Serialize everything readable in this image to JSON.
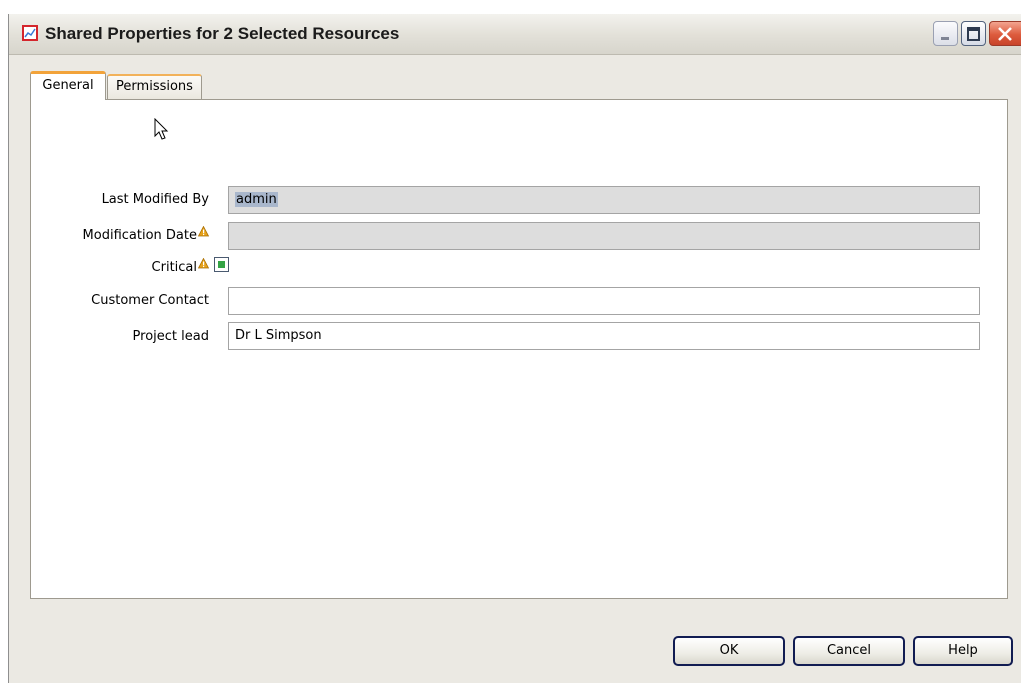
{
  "window": {
    "title": "Shared Properties for 2 Selected Resources",
    "title_icon": "chart-window-icon"
  },
  "tabs": [
    {
      "label": "General",
      "selected": true
    },
    {
      "label": "Permissions",
      "selected": false
    }
  ],
  "form": {
    "last_modified_by": {
      "label": "Last Modified By",
      "value": "admin",
      "readonly": true
    },
    "modification_date": {
      "label": "Modification Date",
      "value": "",
      "readonly": true,
      "icon": "warning-icon"
    },
    "critical": {
      "label": "Critical",
      "checked": true,
      "icon": "warning-icon"
    },
    "customer_contact": {
      "label": "Customer Contact",
      "value": ""
    },
    "project_lead": {
      "label": "Project lead",
      "value": "Dr L Simpson"
    }
  },
  "buttons": {
    "ok": "OK",
    "cancel": "Cancel",
    "help": "Help"
  },
  "colors": {
    "tab_accent": "#f2a33a",
    "readonly_field": "#dddddd",
    "checkbox_mark": "#33a345",
    "warning": "#e6a21c"
  }
}
